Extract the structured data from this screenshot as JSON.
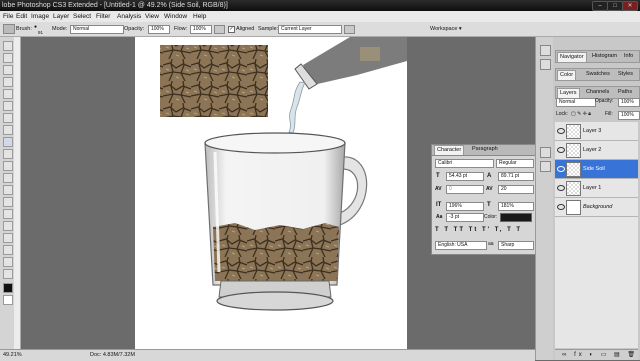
{
  "titlebar": {
    "title": "lobe Photoshop CS3 Extended - [Untitled-1 @ 49.2% (Side Soil, RGB/8)]"
  },
  "menu": [
    "File",
    "Edit",
    "Image",
    "Layer",
    "Select",
    "Filter",
    "Analysis",
    "View",
    "Window",
    "Help"
  ],
  "options": {
    "brush_label": "Brush:",
    "brush_size": "91",
    "mode_label": "Mode:",
    "mode_value": "Normal",
    "opacity_label": "Opacity:",
    "opacity_value": "100%",
    "flow_label": "Flow:",
    "flow_value": "100%",
    "aligned_label": "Aligned",
    "sample_label": "Sample:",
    "sample_value": "Current Layer",
    "workspace_label": "Workspace ▾"
  },
  "status": {
    "zoom": "49.21%",
    "doc": "Doc: 4.83M/7.32M"
  },
  "dock": {
    "group1": [
      "Navigator",
      "Histogram",
      "Info"
    ],
    "group2": [
      "Color",
      "Swatches",
      "Styles"
    ],
    "group3": [
      "Layers",
      "Channels",
      "Paths"
    ],
    "blend_mode": "Normal",
    "opacity_label": "Opacity:",
    "opacity_value": "100%",
    "lock_label": "Lock:",
    "fill_label": "Fill:",
    "fill_value": "100%",
    "layers": [
      "Layer 3",
      "Layer 2",
      "Side Soil",
      "Layer 1",
      "Background"
    ]
  },
  "character": {
    "tabs": [
      "Character",
      "Paragraph"
    ],
    "font_family": "Calibri",
    "font_style": "Regular",
    "size": "54.43 pt",
    "leading": "89.71 pt",
    "kerning": "0",
    "tracking": "20",
    "vscale": "196%",
    "hscale": "181%",
    "baseline": "-3 pt",
    "color_label": "Color:",
    "language": "English: USA",
    "aa": "Sharp"
  }
}
